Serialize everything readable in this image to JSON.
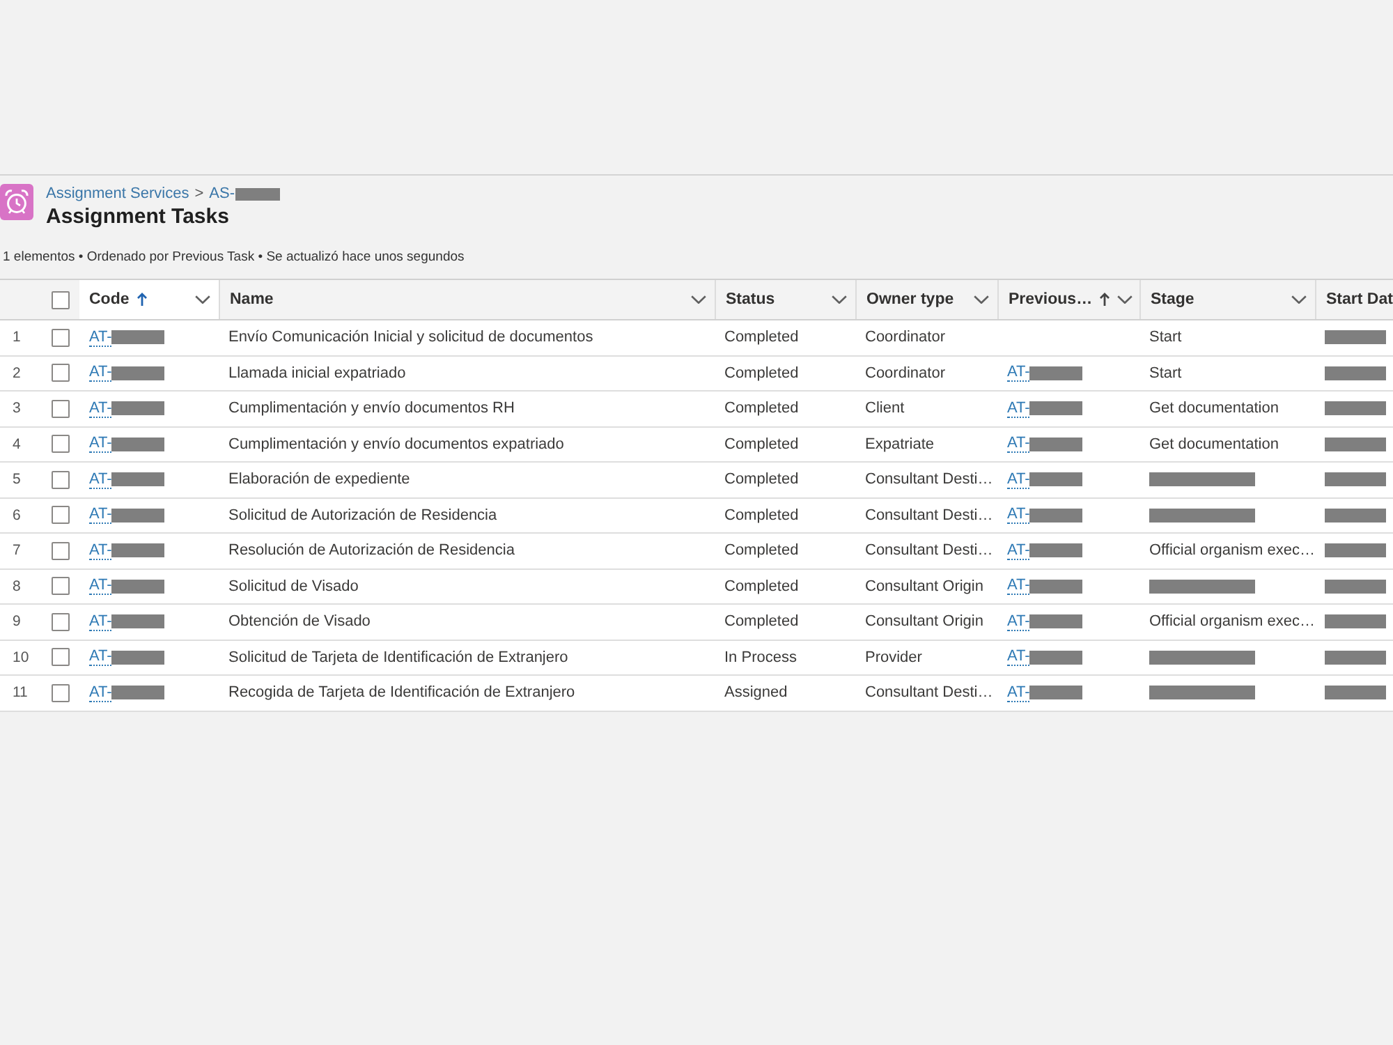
{
  "header": {
    "breadcrumb": {
      "parent": "Assignment Services",
      "separator": ">",
      "current": {
        "text": "AS-",
        "redacted": true
      }
    },
    "title": "Assignment Tasks"
  },
  "summary": "1 elementos • Ordenado por Previous Task • Se actualizó hace unos segundos",
  "table": {
    "select_all": {
      "checked": false
    },
    "columns": [
      {
        "label": "Code",
        "selected": true,
        "sorted": true,
        "dropdown": true
      },
      {
        "label": "Name",
        "selected": false,
        "sorted": false,
        "dropdown": true
      },
      {
        "label": "Status",
        "selected": false,
        "sorted": false,
        "dropdown": true
      },
      {
        "label": "Owner type",
        "selected": false,
        "sorted": false,
        "dropdown": true
      },
      {
        "label": "Previous…",
        "selected": false,
        "sorted": true,
        "dropdown": true
      },
      {
        "label": "Stage",
        "selected": false,
        "sorted": false,
        "dropdown": true
      },
      {
        "label": "Start Dat",
        "selected": false,
        "sorted": false,
        "dropdown": false
      }
    ],
    "rows": [
      {
        "number": "1",
        "checked": false,
        "code": {
          "text": "AT-",
          "redacted": true
        },
        "name": "Envío Comunicación Inicial y solicitud de documentos",
        "status": "Completed",
        "owner_type": "Coordinator",
        "stage": {
          "text": "Start",
          "redacted": false
        },
        "start_date": {
          "redacted": true
        }
      },
      {
        "number": "2",
        "checked": false,
        "code": {
          "text": "AT-",
          "redacted": true
        },
        "name": "Llamada inicial expatriado",
        "status": "Completed",
        "owner_type": "Coordinator",
        "previous_task": {
          "text": "AT-",
          "redacted": true
        },
        "stage": {
          "text": "Start",
          "redacted": false
        },
        "start_date": {
          "redacted": true
        }
      },
      {
        "number": "3",
        "checked": false,
        "code": {
          "text": "AT-",
          "redacted": true
        },
        "name": "Cumplimentación y envío documentos RH",
        "status": "Completed",
        "owner_type": "Client",
        "previous_task": {
          "text": "AT-",
          "redacted": true
        },
        "stage": {
          "text": "Get documentation",
          "redacted": false
        },
        "start_date": {
          "redacted": true
        }
      },
      {
        "number": "4",
        "checked": false,
        "code": {
          "text": "AT-",
          "redacted": true
        },
        "name": "Cumplimentación y envío documentos expatriado",
        "status": "Completed",
        "owner_type": "Expatriate",
        "previous_task": {
          "text": "AT-",
          "redacted": true
        },
        "stage": {
          "text": "Get documentation",
          "redacted": false
        },
        "start_date": {
          "redacted": true
        }
      },
      {
        "number": "5",
        "checked": false,
        "code": {
          "text": "AT-",
          "redacted": true
        },
        "name": "Elaboración de expediente",
        "status": "Completed",
        "owner_type": "Consultant Desti…",
        "previous_task": {
          "text": "AT-",
          "redacted": true
        },
        "stage": {
          "redacted": true
        },
        "start_date": {
          "redacted": true
        }
      },
      {
        "number": "6",
        "checked": false,
        "code": {
          "text": "AT-",
          "redacted": true
        },
        "name": "Solicitud de Autorización de Residencia",
        "status": "Completed",
        "owner_type": "Consultant Desti…",
        "previous_task": {
          "text": "AT-",
          "redacted": true
        },
        "stage": {
          "redacted": true
        },
        "start_date": {
          "redacted": true
        }
      },
      {
        "number": "7",
        "checked": false,
        "code": {
          "text": "AT-",
          "redacted": true
        },
        "name": "Resolución de Autorización de Residencia",
        "status": "Completed",
        "owner_type": "Consultant Desti…",
        "previous_task": {
          "text": "AT-",
          "redacted": true
        },
        "stage": {
          "text": "Official organism exec…",
          "redacted": false
        },
        "start_date": {
          "redacted": true
        }
      },
      {
        "number": "8",
        "checked": false,
        "code": {
          "text": "AT-",
          "redacted": true
        },
        "name": "Solicitud de Visado",
        "status": "Completed",
        "owner_type": "Consultant Origin",
        "previous_task": {
          "text": "AT-",
          "redacted": true
        },
        "stage": {
          "redacted": true
        },
        "start_date": {
          "redacted": true
        }
      },
      {
        "number": "9",
        "checked": false,
        "code": {
          "text": "AT-",
          "redacted": true
        },
        "name": "Obtención de Visado",
        "status": "Completed",
        "owner_type": "Consultant Origin",
        "previous_task": {
          "text": "AT-",
          "redacted": true
        },
        "stage": {
          "text": "Official organism exec…",
          "redacted": false
        },
        "start_date": {
          "redacted": true
        }
      },
      {
        "number": "10",
        "checked": false,
        "code": {
          "text": "AT-",
          "redacted": true
        },
        "name": "Solicitud de Tarjeta de Identificación de Extranjero",
        "status": "In Process",
        "owner_type": "Provider",
        "previous_task": {
          "text": "AT-",
          "redacted": true
        },
        "stage": {
          "redacted": true
        },
        "start_date": {
          "redacted": true
        }
      },
      {
        "number": "11",
        "checked": false,
        "code": {
          "text": "AT-",
          "redacted": true
        },
        "name": "Recogida de Tarjeta de Identificación de Extranjero",
        "status": "Assigned",
        "owner_type": "Consultant Desti…",
        "previous_task": {
          "text": "AT-",
          "redacted": true
        },
        "stage": {
          "redacted": true
        },
        "start_date": {
          "redacted": true
        }
      }
    ]
  }
}
